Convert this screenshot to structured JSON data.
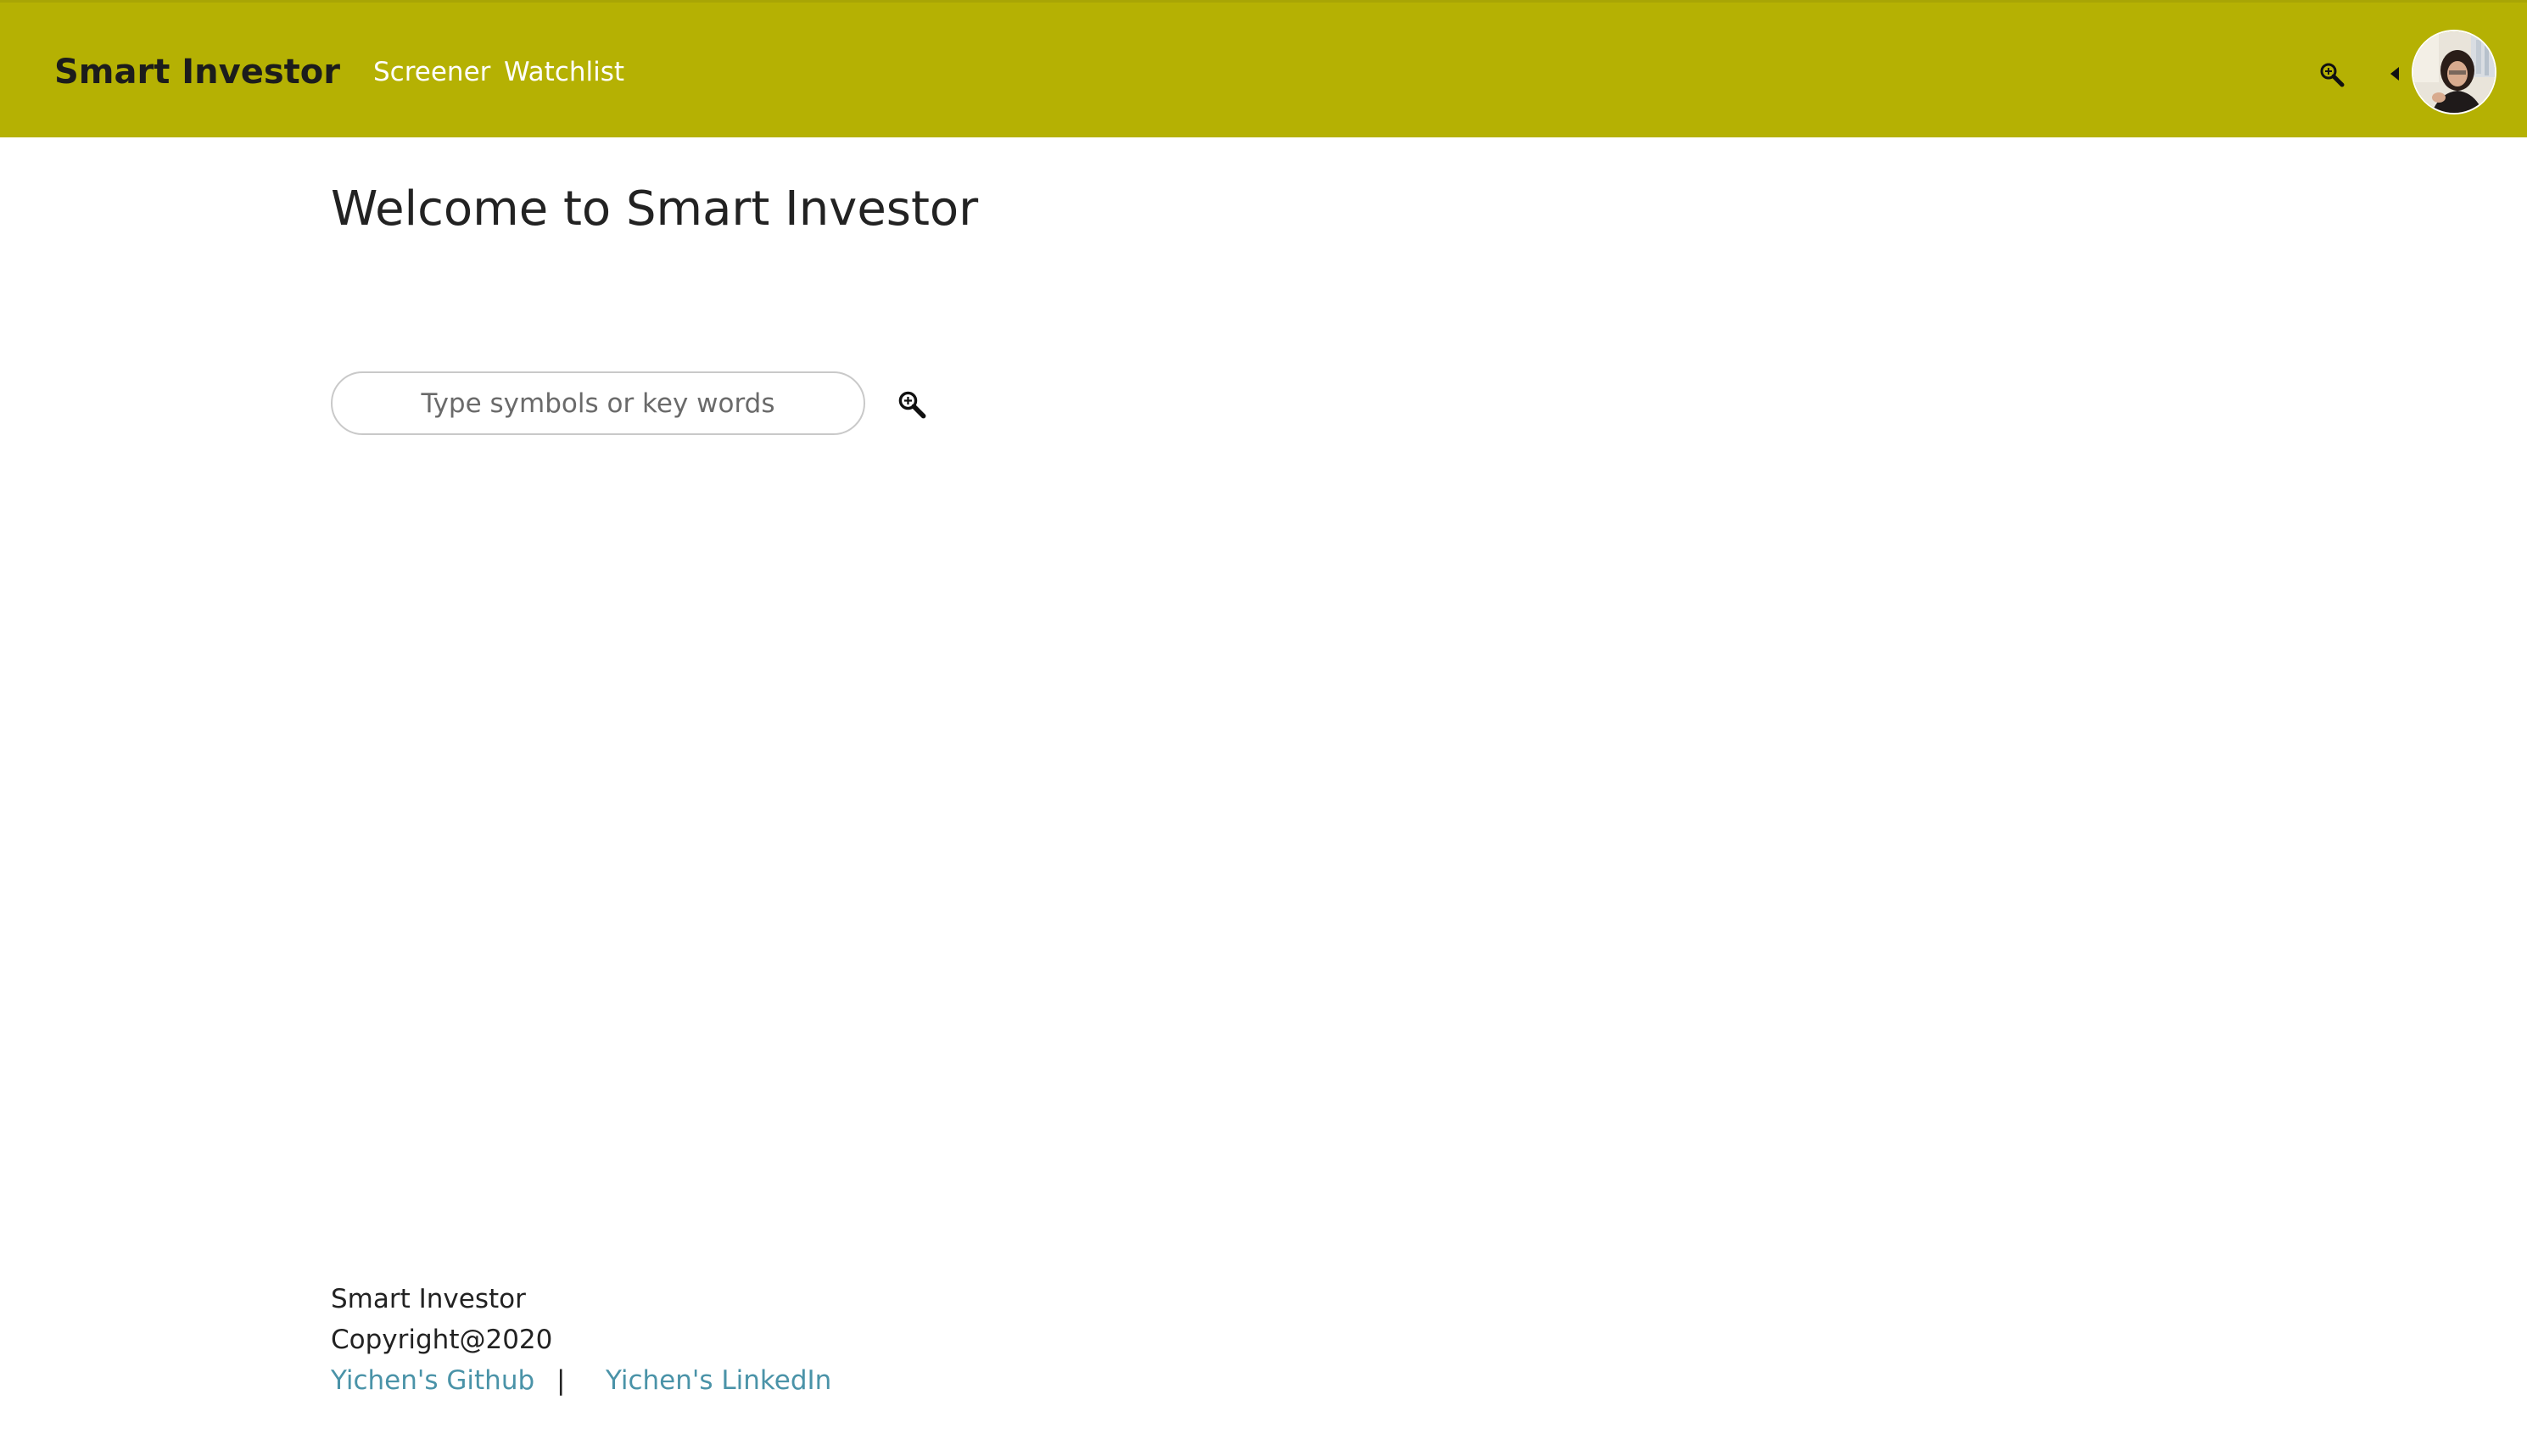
{
  "header": {
    "brand": "Smart Investor",
    "nav": [
      {
        "label": "Screener"
      },
      {
        "label": "Watchlist"
      }
    ],
    "icons": {
      "search": "search-icon",
      "caret": "caret-left-icon",
      "avatar": "user-avatar"
    },
    "background_color": "#b5b103"
  },
  "main": {
    "title": "Welcome to Smart Investor",
    "search": {
      "placeholder": "Type symbols or key words",
      "value": ""
    }
  },
  "footer": {
    "brand": "Smart Investor",
    "copyright": "Copyright@2020",
    "links": [
      {
        "label": "Yichen's Github"
      },
      {
        "label": "Yichen's LinkedIn"
      }
    ],
    "separator": "|",
    "link_color": "#4a93a8"
  }
}
